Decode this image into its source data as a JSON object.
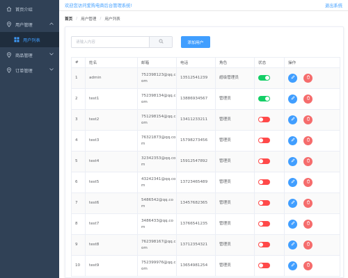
{
  "header": {
    "welcome": "欢迎您访问爱购电商后台管理系统!",
    "logout": "退出系统"
  },
  "sidebar": {
    "home": "首页介绍",
    "users": "用户管理",
    "user_list": "用户列表",
    "products": "商品管理",
    "orders": "订单管理"
  },
  "breadcrumb": {
    "home": "首页",
    "section": "用户管理",
    "current": "用户列表"
  },
  "search": {
    "placeholder": "请输入内容",
    "value": ""
  },
  "add_button": "添加用户",
  "table": {
    "headers": [
      "#",
      "姓名",
      "邮箱",
      "电话",
      "角色",
      "状态",
      "操作"
    ],
    "rows": [
      {
        "idx": "1",
        "name": "admin",
        "email": "752398123@qq.com",
        "phone": "13512541239",
        "role": "超级管理员",
        "status": true
      },
      {
        "idx": "2",
        "name": "test1",
        "email": "752398134@qq.com",
        "phone": "13886934567",
        "role": "管理员",
        "status": true
      },
      {
        "idx": "3",
        "name": "test2",
        "email": "751298154@qq.com",
        "phone": "13411233211",
        "role": "管理员",
        "status": false
      },
      {
        "idx": "4",
        "name": "test3",
        "email": "76321873@qq.com",
        "phone": "15798273456",
        "role": "管理员",
        "status": false
      },
      {
        "idx": "5",
        "name": "test4",
        "email": "32342353@qq.com",
        "phone": "15912547892",
        "role": "管理员",
        "status": false
      },
      {
        "idx": "6",
        "name": "test5",
        "email": "43242341@qq.com",
        "phone": "13723465489",
        "role": "管理员",
        "status": false
      },
      {
        "idx": "7",
        "name": "test6",
        "email": "5486542@qq.com",
        "phone": "13457682365",
        "role": "管理员",
        "status": false
      },
      {
        "idx": "8",
        "name": "test7",
        "email": "3486433@qq.com",
        "phone": "13766541235",
        "role": "管理员",
        "status": false
      },
      {
        "idx": "9",
        "name": "test8",
        "email": "762398167@qq.com",
        "phone": "13712354321",
        "role": "管理员",
        "status": false
      },
      {
        "idx": "10",
        "name": "test9",
        "email": "752399976@qq.com",
        "phone": "13654981254",
        "role": "管理员",
        "status": false
      }
    ]
  },
  "colors": {
    "primary": "#409eff",
    "sidebar": "#304156",
    "switch_on": "#13ce66",
    "switch_off": "#ff4949",
    "danger": "#f56c6c"
  },
  "icons": {
    "home": "home-icon",
    "users": "location-icon",
    "user_list": "grid-icon",
    "products": "location-icon",
    "orders": "location-icon",
    "search": "search-icon",
    "edit": "edit-icon",
    "delete": "delete-icon"
  }
}
